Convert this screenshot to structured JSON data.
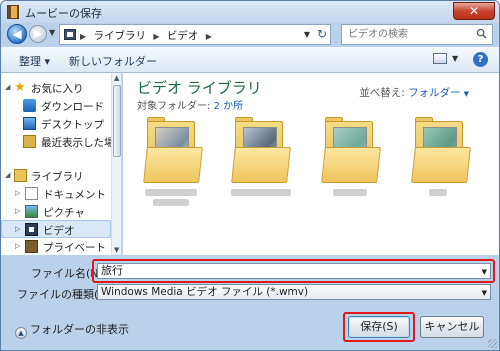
{
  "window": {
    "title": "ムービーの保存",
    "close_label": "✕"
  },
  "nav": {
    "back_glyph": "◀",
    "forward_glyph": "▶",
    "breadcrumbs": [
      "ライブラリ",
      "ビデオ"
    ],
    "breadcrumb_sep": "▶",
    "refresh_glyph": "↻",
    "search_placeholder": "ビデオの検索"
  },
  "toolbar": {
    "organize_label": "整理 ▾",
    "new_folder_label": "新しいフォルダー",
    "help_label": "?"
  },
  "navpane": {
    "items": [
      {
        "label": "お気に入り",
        "icon": "star-icon",
        "arrow": "◢"
      },
      {
        "label": "ダウンロード",
        "icon": "download-folder-icon"
      },
      {
        "label": "デスクトップ",
        "icon": "desktop-icon"
      },
      {
        "label": "最近表示した場所",
        "icon": "recent-places-icon"
      },
      {
        "label": "ライブラリ",
        "icon": "library-icon",
        "arrow": "◢"
      },
      {
        "label": "ドキュメント",
        "icon": "documents-icon",
        "arrow": "▷"
      },
      {
        "label": "ピクチャ",
        "icon": "pictures-icon",
        "arrow": "▷"
      },
      {
        "label": "ビデオ",
        "icon": "videos-icon",
        "arrow": "▷"
      },
      {
        "label": "プライベート",
        "icon": "private-icon",
        "arrow": "▷"
      }
    ]
  },
  "content": {
    "title": "ビデオ ライブラリ",
    "subtitle_prefix": "対象フォルダー: ",
    "subtitle_link": "2 か所",
    "arrange_prefix": "並べ替え:",
    "arrange_value": "フォルダー",
    "arrange_dropdown": "▼",
    "folders": [
      {
        "icon": "video-folder-icon",
        "colors": [
          "#7a8fa4",
          "#d8d0c2"
        ]
      },
      {
        "icon": "video-folder-icon",
        "colors": [
          "#5a6b7d",
          "#b8c6d4"
        ]
      },
      {
        "icon": "video-folder-icon",
        "colors": [
          "#6fa89a",
          "#a9d1c4"
        ]
      },
      {
        "icon": "video-folder-icon",
        "colors": [
          "#5d9a87",
          "#9cc9b8"
        ]
      }
    ]
  },
  "form": {
    "filename_label": "ファイル名(N):",
    "filename_value": "旅行",
    "filetype_label": "ファイルの種類(T):",
    "filetype_value": "Windows Media ビデオ ファイル (*.wmv)",
    "dropdown_glyph": "▼"
  },
  "footer": {
    "hide_folders_label": "フォルダーの非表示",
    "hide_glyph": "▲",
    "save_label": "保存(S)",
    "cancel_label": "キャンセル"
  },
  "colors": {
    "highlight_outline": "#e01919",
    "library_title": "#1e6a3e",
    "link": "#1b5fb8"
  }
}
